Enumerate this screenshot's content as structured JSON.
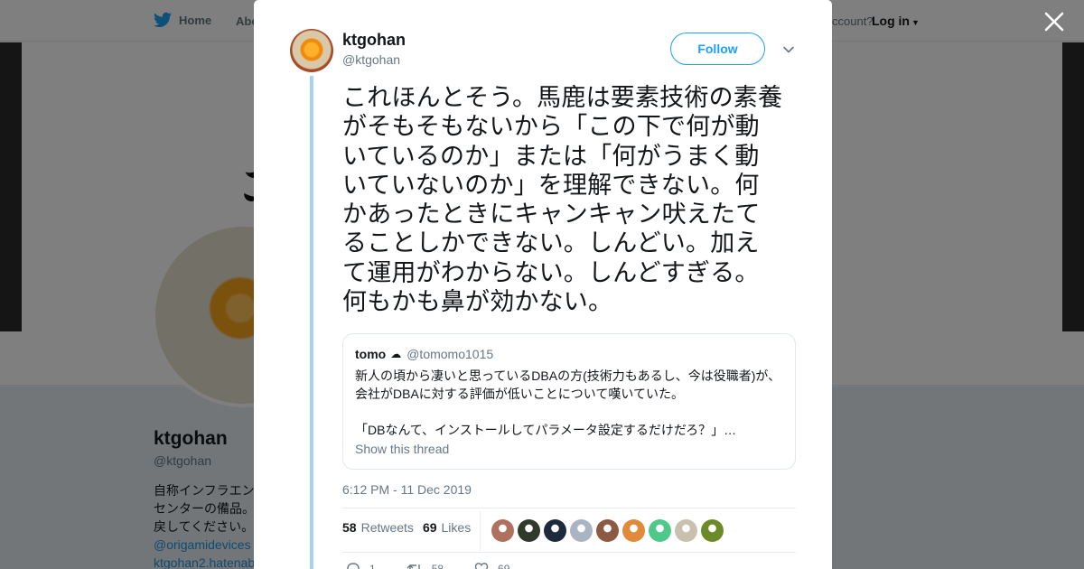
{
  "nav": {
    "home_label": "Home",
    "about_label": "Abo",
    "account_text": "ccount?",
    "login_label": "Log in"
  },
  "profile": {
    "name": "ktgohan",
    "handle": "@ktgohan",
    "bio_lines": [
      "自称インフラエン",
      "センターの備品。",
      "戻してください。US"
    ],
    "links": [
      "@origamidevices",
      "ktgohan2.hatenab"
    ]
  },
  "tweet": {
    "author_name": "ktgohan",
    "author_handle": "@ktgohan",
    "follow_label": "Follow",
    "text_lines": [
      "これほんとそう。馬鹿は要素技術の素養",
      "がそもそもないから「この下で何が動",
      "いているのか」または「何がうまく動",
      "いていないのか」を理解できない。何",
      "かあったときにキャンキャン吠えたて",
      "ることしかできない。しんどい。加え",
      "て運用がわからない。しんどすぎる。",
      "何もかも鼻が効かない。"
    ],
    "timestamp": "6:12 PM - 11 Dec 2019",
    "retweets_count": "58",
    "retweets_label": "Retweets",
    "likes_count": "69",
    "likes_label": "Likes",
    "reply_count": "1",
    "retweet_action_count": "58",
    "like_action_count": "69"
  },
  "quote": {
    "name": "tomo",
    "emoji": "☁",
    "handle": "@tomomo1015",
    "lines": [
      "新人の頃から凄いと思っているDBAの方(技術力もあるし、今は役職者)が、",
      "会社がDBAに対する評価が低いことについて嘆いていた。",
      "",
      "「DBなんて、インストールしてパラメータ設定するだけだろ？」…"
    ],
    "show_thread_label": "Show this thread"
  },
  "colors": {
    "accent": "#1da1f2",
    "thread_line": "#a3d3f5",
    "liker_avatars": [
      "#b07060",
      "#2e3b2a",
      "#1c2a3c",
      "#aab4c2",
      "#8a5a44",
      "#e08a3a",
      "#4ec98a",
      "#c9c0b0",
      "#6b8a2a"
    ]
  },
  "icons": [
    "twitter-bird-icon",
    "close-icon",
    "chevron-down-icon",
    "reply-icon",
    "retweet-icon",
    "heart-icon"
  ]
}
